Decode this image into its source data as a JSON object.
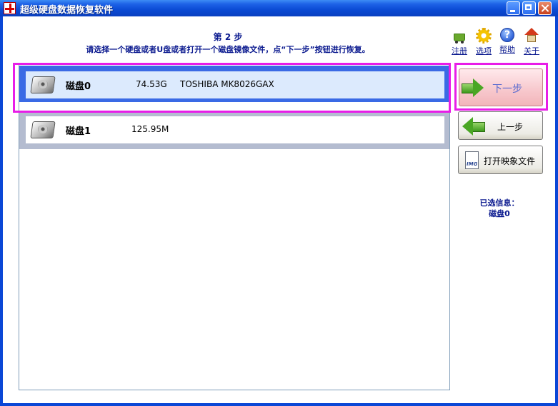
{
  "window": {
    "title": "超级硬盘数据恢复软件"
  },
  "header": {
    "step_title": "第 2 步",
    "step_hint": "请选择一个硬盘或者U盘或者打开一个磁盘镜像文件，点“下一步”按钮进行恢复。"
  },
  "toolbar": {
    "items": [
      {
        "label": "注册",
        "icon": "cart-check-icon"
      },
      {
        "label": "选项",
        "icon": "gear-icon"
      },
      {
        "label": "帮助",
        "icon": "help-icon"
      },
      {
        "label": "关于",
        "icon": "house-icon"
      }
    ]
  },
  "disks": [
    {
      "name": "磁盘0",
      "size": "74.53G",
      "model": "TOSHIBA MK8026GAX",
      "selected": true,
      "icon": "hard-disk-icon"
    },
    {
      "name": "磁盘1",
      "size": "125.95M",
      "model": "",
      "selected": false,
      "icon": "hard-disk-icon"
    }
  ],
  "buttons": {
    "next": "下一步",
    "prev": "上一步",
    "open_image": "打开映象文件",
    "image_icon_text": "IMG"
  },
  "selection": {
    "label": "已选信息：",
    "value": "磁盘0"
  },
  "colors": {
    "titlebar": "#0b4ad4",
    "accent_text": "#0b1a8f",
    "selected_row": "#3a6ae5",
    "highlight": "#e81de8"
  }
}
